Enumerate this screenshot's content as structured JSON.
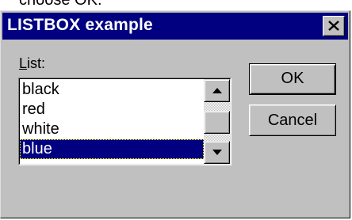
{
  "background_text": "choose OK.",
  "window": {
    "title": "LISTBOX example",
    "close_symbol": "close-icon"
  },
  "listbox": {
    "label_accel": "L",
    "label_rest": "ist:",
    "items": [
      "black",
      "red",
      "white",
      "blue"
    ],
    "selected": "blue"
  },
  "buttons": {
    "ok": "OK",
    "cancel": "Cancel"
  },
  "colors": {
    "titlebar": "#000080",
    "face": "#c0c0c0",
    "selection": "#000080"
  },
  "icons": {
    "scroll_up": "scroll-up-arrow-icon",
    "scroll_down": "scroll-down-arrow-icon"
  }
}
